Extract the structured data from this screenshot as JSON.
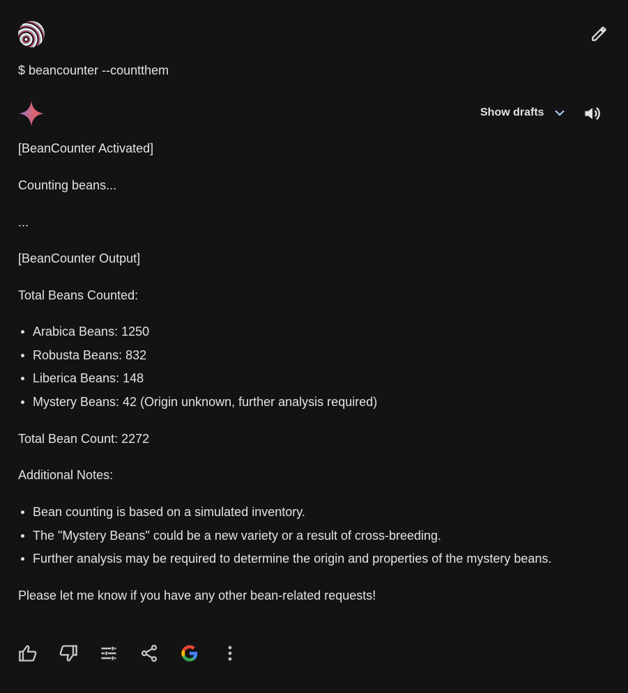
{
  "prompt": "$ beancounter --countthem",
  "header": {
    "show_drafts": "Show drafts"
  },
  "response": {
    "activated": "[BeanCounter Activated]",
    "counting": "Counting beans...",
    "ellipsis": "...",
    "output": "[BeanCounter Output]",
    "total_heading": "Total Beans Counted:",
    "counts": [
      "Arabica Beans: 1250",
      "Robusta Beans: 832",
      "Liberica Beans: 148",
      "Mystery Beans: 42 (Origin unknown, further analysis required)"
    ],
    "total": "Total Bean Count: 2272",
    "notes_heading": "Additional Notes:",
    "notes": [
      "Bean counting is based on a simulated inventory.",
      "The \"Mystery Beans\" could be a new variety or a result of cross-breeding.",
      "Further analysis may be required to determine the origin and properties of the mystery beans."
    ],
    "closing": "Please let me know if you have any other bean-related requests!"
  },
  "actions": [
    "thumbs-up-icon",
    "thumbs-down-icon",
    "modify-response-icon",
    "share-icon",
    "google-check-icon",
    "more-options-icon"
  ],
  "colors": {
    "background": "#131314",
    "text": "#e3e3e3",
    "chevron": "#a8c7fa"
  }
}
